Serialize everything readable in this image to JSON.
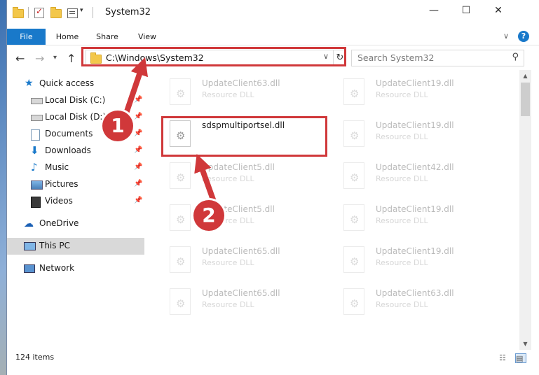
{
  "window": {
    "title": "System32",
    "minimize_glyph": "—",
    "maximize_glyph": "☐",
    "close_glyph": "✕"
  },
  "ribbon": {
    "tabs": [
      {
        "label": "File"
      },
      {
        "label": "Home"
      },
      {
        "label": "Share"
      },
      {
        "label": "View"
      }
    ],
    "expand_glyph": "∨",
    "help_glyph": "?"
  },
  "nav": {
    "back_glyph": "←",
    "forward_glyph": "→",
    "recent_glyph": "▾",
    "up_glyph": "↑"
  },
  "address": {
    "path": "C:\\Windows\\System32",
    "dropdown_glyph": "∨",
    "refresh_glyph": "↻"
  },
  "search": {
    "placeholder": "Search System32",
    "icon_glyph": "⚲"
  },
  "sidebar": {
    "items": [
      {
        "label": "Quick access",
        "icon": "star-icon",
        "pinned": false
      },
      {
        "label": "Local Disk (C:)",
        "icon": "drive-icon",
        "pinned": true
      },
      {
        "label": "Local Disk (D:)",
        "icon": "drive-icon",
        "pinned": true
      },
      {
        "label": "Documents",
        "icon": "documents-icon",
        "pinned": true
      },
      {
        "label": "Downloads",
        "icon": "download-icon",
        "pinned": true
      },
      {
        "label": "Music",
        "icon": "music-icon",
        "pinned": true
      },
      {
        "label": "Pictures",
        "icon": "pictures-icon",
        "pinned": true
      },
      {
        "label": "Videos",
        "icon": "videos-icon",
        "pinned": true
      },
      {
        "label": "OneDrive",
        "icon": "cloud-icon",
        "pinned": false
      },
      {
        "label": "This PC",
        "icon": "computer-icon",
        "pinned": false,
        "selected": true
      },
      {
        "label": "Network",
        "icon": "network-icon",
        "pinned": false
      }
    ],
    "pin_glyph": "📌"
  },
  "files": {
    "left": [
      {
        "name": "UpdateClient63.dll",
        "type": "Resource DLL"
      },
      {
        "name": "sdspmultiportsel.dll",
        "type": ""
      },
      {
        "name": "UpdateClient5.dll",
        "type": "Resource DLL"
      },
      {
        "name": "UpdateClient5.dll",
        "type": "Resource DLL"
      },
      {
        "name": "UpdateClient65.dll",
        "type": "Resource DLL"
      },
      {
        "name": "UpdateClient65.dll",
        "type": "Resource DLL"
      }
    ],
    "right": [
      {
        "name": "UpdateClient19.dll",
        "type": "Resource DLL"
      },
      {
        "name": "UpdateClient19.dll",
        "type": "Resource DLL"
      },
      {
        "name": "UpdateClient42.dll",
        "type": "Resource DLL"
      },
      {
        "name": "UpdateClient19.dll",
        "type": "Resource DLL"
      },
      {
        "name": "UpdateClient19.dll",
        "type": "Resource DLL"
      },
      {
        "name": "UpdateClient63.dll",
        "type": "Resource DLL"
      }
    ]
  },
  "annotations": {
    "step1": "1",
    "step2": "2",
    "color": "#d0383a"
  },
  "status": {
    "item_count": "124 items"
  },
  "colors": {
    "accent": "#1979ca",
    "highlight": "#d0383a"
  }
}
